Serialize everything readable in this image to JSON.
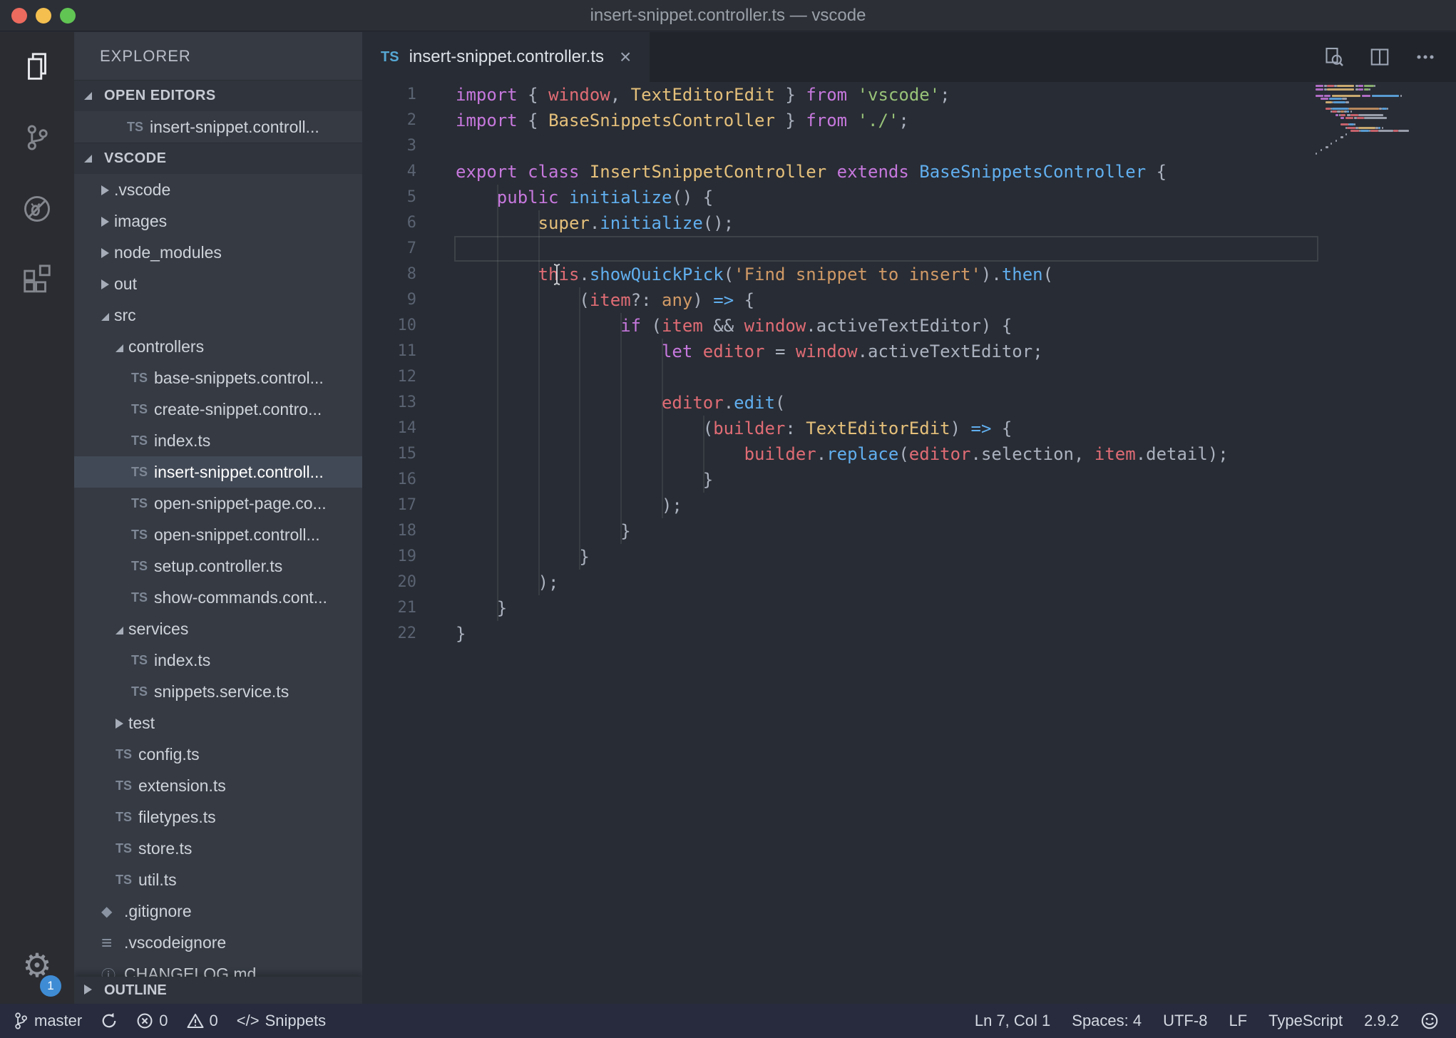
{
  "window": {
    "title": "insert-snippet.controller.ts — vscode"
  },
  "activity_bar": {
    "items": [
      {
        "name": "explorer",
        "active": true
      },
      {
        "name": "source-control",
        "active": false
      },
      {
        "name": "debug",
        "active": false
      },
      {
        "name": "extensions",
        "active": false
      }
    ],
    "settings_badge": "1"
  },
  "sidebar": {
    "title": "EXPLORER",
    "open_editors": {
      "header": "OPEN EDITORS",
      "items": [
        {
          "label": "insert-snippet.controll...",
          "icon": "ts"
        }
      ]
    },
    "folder_section": {
      "header": "VSCODE"
    },
    "outline_section": {
      "header": "OUTLINE"
    },
    "tree": [
      {
        "label": ".vscode",
        "kind": "folder",
        "level": 1,
        "expanded": false
      },
      {
        "label": "images",
        "kind": "folder",
        "level": 1,
        "expanded": false
      },
      {
        "label": "node_modules",
        "kind": "folder",
        "level": 1,
        "expanded": false
      },
      {
        "label": "out",
        "kind": "folder",
        "level": 1,
        "expanded": false
      },
      {
        "label": "src",
        "kind": "folder",
        "level": 1,
        "expanded": true
      },
      {
        "label": "controllers",
        "kind": "folder",
        "level": 2,
        "expanded": true
      },
      {
        "label": "base-snippets.control...",
        "kind": "file",
        "icon": "ts",
        "level": 3
      },
      {
        "label": "create-snippet.contro...",
        "kind": "file",
        "icon": "ts",
        "level": 3
      },
      {
        "label": "index.ts",
        "kind": "file",
        "icon": "ts",
        "level": 3
      },
      {
        "label": "insert-snippet.controll...",
        "kind": "file",
        "icon": "ts",
        "level": 3,
        "selected": true
      },
      {
        "label": "open-snippet-page.co...",
        "kind": "file",
        "icon": "ts",
        "level": 3
      },
      {
        "label": "open-snippet.controll...",
        "kind": "file",
        "icon": "ts",
        "level": 3
      },
      {
        "label": "setup.controller.ts",
        "kind": "file",
        "icon": "ts",
        "level": 3
      },
      {
        "label": "show-commands.cont...",
        "kind": "file",
        "icon": "ts",
        "level": 3
      },
      {
        "label": "services",
        "kind": "folder",
        "level": 2,
        "expanded": true
      },
      {
        "label": "index.ts",
        "kind": "file",
        "icon": "ts",
        "level": 3
      },
      {
        "label": "snippets.service.ts",
        "kind": "file",
        "icon": "ts",
        "level": 3
      },
      {
        "label": "test",
        "kind": "folder",
        "level": 2,
        "expanded": false
      },
      {
        "label": "config.ts",
        "kind": "file",
        "icon": "ts",
        "level": 2
      },
      {
        "label": "extension.ts",
        "kind": "file",
        "icon": "ts",
        "level": 2
      },
      {
        "label": "filetypes.ts",
        "kind": "file",
        "icon": "ts",
        "level": 2
      },
      {
        "label": "store.ts",
        "kind": "file",
        "icon": "ts",
        "level": 2
      },
      {
        "label": "util.ts",
        "kind": "file",
        "icon": "ts",
        "level": 2
      },
      {
        "label": ".gitignore",
        "kind": "file",
        "icon": "git",
        "level": 1
      },
      {
        "label": ".vscodeignore",
        "kind": "file",
        "icon": "list",
        "level": 1
      },
      {
        "label": "CHANGELOG.md",
        "kind": "file",
        "icon": "info",
        "level": 1
      }
    ]
  },
  "editor": {
    "tab": {
      "icon": "TS",
      "label": "insert-snippet.controller.ts",
      "close": "×"
    },
    "actions": [
      "search-in-file",
      "split-editor",
      "more-actions"
    ],
    "current_line": 7,
    "cursor": {
      "line": 7,
      "col": 1
    },
    "lines": [
      {
        "num": 1,
        "tokens": [
          [
            "kw",
            "import"
          ],
          [
            "pln",
            " { "
          ],
          [
            "var",
            "window"
          ],
          [
            "pln",
            ", "
          ],
          [
            "typ",
            "TextEditorEdit"
          ],
          [
            "pln",
            " } "
          ],
          [
            "kw",
            "from"
          ],
          [
            "pln",
            " "
          ],
          [
            "str",
            "'vscode'"
          ],
          [
            "pln",
            ";"
          ]
        ]
      },
      {
        "num": 2,
        "tokens": [
          [
            "kw",
            "import"
          ],
          [
            "pln",
            " { "
          ],
          [
            "typ",
            "BaseSnippetsController"
          ],
          [
            "pln",
            " } "
          ],
          [
            "kw",
            "from"
          ],
          [
            "pln",
            " "
          ],
          [
            "str",
            "'./'"
          ],
          [
            "pln",
            ";"
          ]
        ]
      },
      {
        "num": 3,
        "tokens": []
      },
      {
        "num": 4,
        "tokens": [
          [
            "kw",
            "export"
          ],
          [
            "pln",
            " "
          ],
          [
            "kw",
            "class"
          ],
          [
            "pln",
            " "
          ],
          [
            "typ",
            "InsertSnippetController"
          ],
          [
            "pln",
            " "
          ],
          [
            "kw",
            "extends"
          ],
          [
            "pln",
            " "
          ],
          [
            "cls2",
            "BaseSnippetsController"
          ],
          [
            "pln",
            " {"
          ]
        ]
      },
      {
        "num": 5,
        "tokens": [
          [
            "pln",
            "    "
          ],
          [
            "kw",
            "public"
          ],
          [
            "pln",
            " "
          ],
          [
            "fn",
            "initialize"
          ],
          [
            "pln",
            "() {"
          ]
        ]
      },
      {
        "num": 6,
        "tokens": [
          [
            "pln",
            "        "
          ],
          [
            "typ",
            "super"
          ],
          [
            "pln",
            "."
          ],
          [
            "fn",
            "initialize"
          ],
          [
            "pln",
            "();"
          ]
        ]
      },
      {
        "num": 7,
        "tokens": []
      },
      {
        "num": 8,
        "tokens": [
          [
            "pln",
            "        "
          ],
          [
            "var",
            "this"
          ],
          [
            "pln",
            "."
          ],
          [
            "fn",
            "showQuickPick"
          ],
          [
            "pln",
            "("
          ],
          [
            "stro",
            "'Find snippet to insert'"
          ],
          [
            "pln",
            ")."
          ],
          [
            "fn",
            "then"
          ],
          [
            "pln",
            "("
          ]
        ]
      },
      {
        "num": 9,
        "tokens": [
          [
            "pln",
            "            ("
          ],
          [
            "var",
            "item"
          ],
          [
            "pln",
            "?: "
          ],
          [
            "stro",
            "any"
          ],
          [
            "pln",
            ") "
          ],
          [
            "op",
            "=>"
          ],
          [
            "pln",
            " {"
          ]
        ]
      },
      {
        "num": 10,
        "tokens": [
          [
            "pln",
            "                "
          ],
          [
            "kw",
            "if"
          ],
          [
            "pln",
            " ("
          ],
          [
            "var",
            "item"
          ],
          [
            "pln",
            " && "
          ],
          [
            "var",
            "window"
          ],
          [
            "pln",
            ".activeTextEditor) {"
          ]
        ]
      },
      {
        "num": 11,
        "tokens": [
          [
            "pln",
            "                    "
          ],
          [
            "kw",
            "let"
          ],
          [
            "pln",
            " "
          ],
          [
            "var",
            "editor"
          ],
          [
            "pln",
            " = "
          ],
          [
            "var",
            "window"
          ],
          [
            "pln",
            ".activeTextEditor;"
          ]
        ]
      },
      {
        "num": 12,
        "tokens": []
      },
      {
        "num": 13,
        "tokens": [
          [
            "pln",
            "                    "
          ],
          [
            "var",
            "editor"
          ],
          [
            "pln",
            "."
          ],
          [
            "fn",
            "edit"
          ],
          [
            "pln",
            "("
          ]
        ]
      },
      {
        "num": 14,
        "tokens": [
          [
            "pln",
            "                        ("
          ],
          [
            "var",
            "builder"
          ],
          [
            "pln",
            ": "
          ],
          [
            "typ",
            "TextEditorEdit"
          ],
          [
            "pln",
            ") "
          ],
          [
            "op",
            "=>"
          ],
          [
            "pln",
            " {"
          ]
        ]
      },
      {
        "num": 15,
        "tokens": [
          [
            "pln",
            "                            "
          ],
          [
            "var",
            "builder"
          ],
          [
            "pln",
            "."
          ],
          [
            "fn",
            "replace"
          ],
          [
            "pln",
            "("
          ],
          [
            "var",
            "editor"
          ],
          [
            "pln",
            ".selection, "
          ],
          [
            "var",
            "item"
          ],
          [
            "pln",
            ".detail);"
          ]
        ]
      },
      {
        "num": 16,
        "tokens": [
          [
            "pln",
            "                        }"
          ]
        ]
      },
      {
        "num": 17,
        "tokens": [
          [
            "pln",
            "                    );"
          ]
        ]
      },
      {
        "num": 18,
        "tokens": [
          [
            "pln",
            "                }"
          ]
        ]
      },
      {
        "num": 19,
        "tokens": [
          [
            "pln",
            "            }"
          ]
        ]
      },
      {
        "num": 20,
        "tokens": [
          [
            "pln",
            "        );"
          ]
        ]
      },
      {
        "num": 21,
        "tokens": [
          [
            "pln",
            "    }"
          ]
        ]
      },
      {
        "num": 22,
        "tokens": [
          [
            "pln",
            "}"
          ]
        ]
      }
    ]
  },
  "status_bar": {
    "left": [
      {
        "name": "git-branch",
        "icon": "branch",
        "label": "master"
      },
      {
        "name": "sync",
        "icon": "refresh",
        "label": ""
      },
      {
        "name": "errors",
        "icon": "error",
        "label": "0"
      },
      {
        "name": "warnings",
        "icon": "warning",
        "label": "0"
      },
      {
        "name": "snippets-extension",
        "icon_text": "</>",
        "label": "Snippets"
      }
    ],
    "right": [
      {
        "name": "cursor-position",
        "label": "Ln 7, Col 1"
      },
      {
        "name": "indentation",
        "label": "Spaces: 4"
      },
      {
        "name": "encoding",
        "label": "UTF-8"
      },
      {
        "name": "eol",
        "label": "LF"
      },
      {
        "name": "language-mode",
        "label": "TypeScript"
      },
      {
        "name": "typescript-version",
        "label": "2.9.2"
      },
      {
        "name": "feedback",
        "icon": "smiley",
        "label": ""
      }
    ]
  },
  "colors": {
    "badge": "#3f8cd5",
    "selection_row": "#414956",
    "tab_ts_icon": "#56a8d4"
  }
}
